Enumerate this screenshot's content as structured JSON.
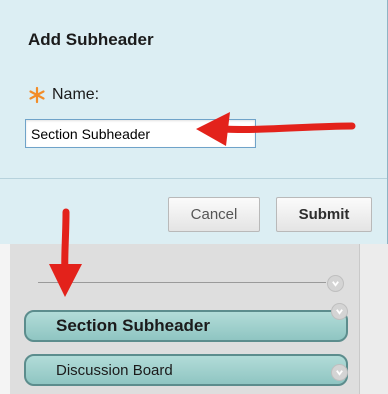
{
  "dialog": {
    "title": "Add Subheader",
    "name_label": "Name:",
    "name_value": "Section Subheader",
    "required_icon": "asterisk-icon",
    "cancel_label": "Cancel",
    "submit_label": "Submit"
  },
  "menu": {
    "items": [
      {
        "label": "Section Subheader",
        "type": "subheader"
      },
      {
        "label": "Discussion Board",
        "type": "link"
      }
    ],
    "chevron_icon": "chevron-down-icon"
  },
  "colors": {
    "dialog_bg": "#dceef3",
    "menu_item_bg": "#9fd0cc",
    "required_icon": "#f28c28",
    "arrow": "#e3221b"
  }
}
